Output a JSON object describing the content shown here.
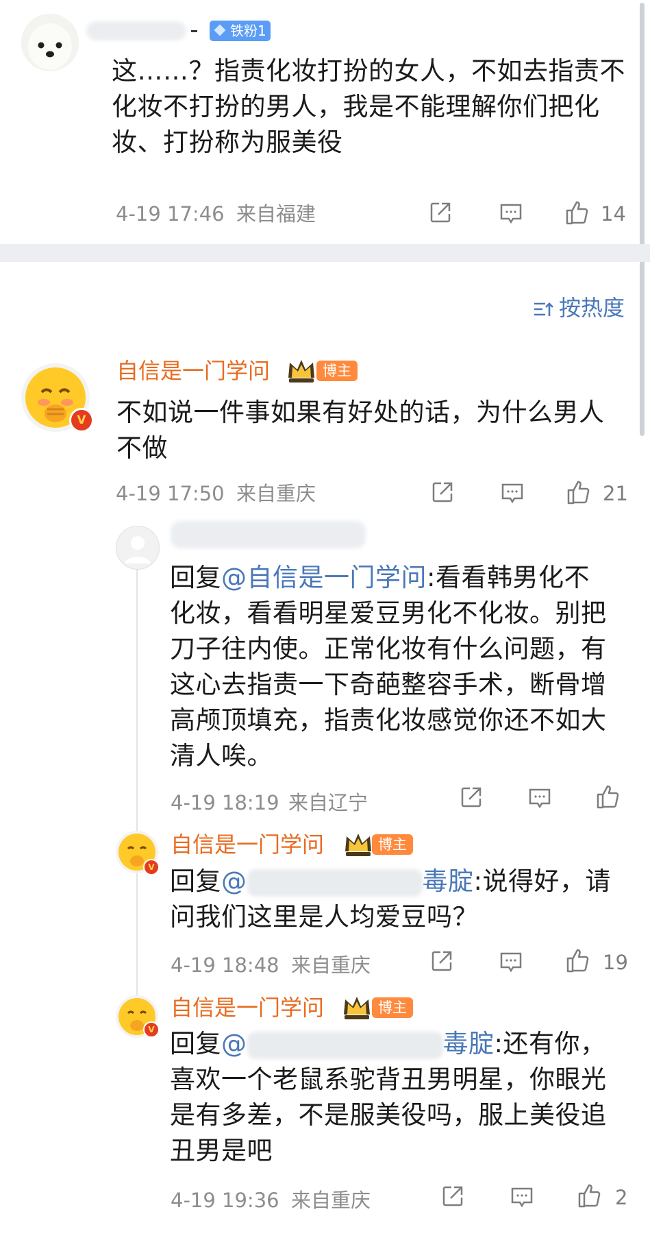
{
  "top_comment": {
    "fan_badge": "铁粉1",
    "text": "这……？指责化妆打扮的女人，不如去指责不化妆不打扮的男人，我是不能理解你们把化妆、打扮称为服美役",
    "time": "4-19 17:46",
    "location": "来自福建",
    "likes": "14"
  },
  "sort": {
    "label": "按热度"
  },
  "main_comment": {
    "author": "自信是一门学问",
    "badge": "博主",
    "text": "不如说一件事如果有好处的话，为什么男人不做",
    "time": "4-19 17:50",
    "location": "来自重庆",
    "likes": "21"
  },
  "replies": [
    {
      "prefix": "回复",
      "mention": "@自信是一门学问",
      "text": ":看看韩男化不化妆，看看明星爱豆男化不化妆。别把刀子往内使。正常化妆有什么问题，有这心去指责一下奇葩整容手术，断骨增高颅顶填充，指责化妆感觉你还不如大清人唉。",
      "time": "4-19 18:19",
      "location": "来自辽宁",
      "likes": ""
    },
    {
      "author": "自信是一门学问",
      "badge": "博主",
      "prefix": "回复",
      "mention": "@",
      "mention_tail": "毒腚",
      "text": ":说得好，请问我们这里是人均爱豆吗？",
      "time": "4-19 18:48",
      "location": "来自重庆",
      "likes": "19"
    },
    {
      "author": "自信是一门学问",
      "badge": "博主",
      "prefix": "回复",
      "mention": "@",
      "mention_tail": "毒腚",
      "text": ":还有你，喜欢一个老鼠系驼背丑男明星，你眼光是有多差，不是服美役吗，服上美役追丑男是吧",
      "time": "4-19 19:36",
      "location": "来自重庆",
      "likes": "2"
    }
  ],
  "icons": {
    "share": "share-icon",
    "comment": "comment-icon",
    "like": "thumbs-up-icon",
    "sort": "sort-icon",
    "crown": "crown-icon",
    "verified": "verified-icon"
  },
  "colors": {
    "accent_orange": "#e86b1f",
    "mention_blue": "#4a78b8",
    "fan_badge_blue": "#5a9cf6",
    "meta_gray": "#8d8d8d"
  }
}
